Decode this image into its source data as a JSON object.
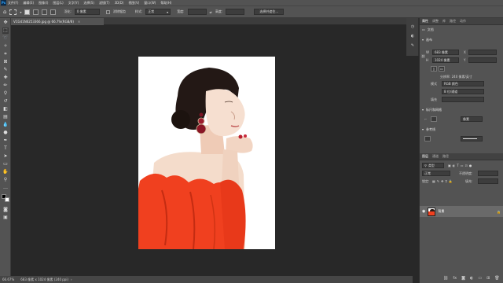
{
  "menubar": {
    "logo": "Ps",
    "items": [
      "文件(F)",
      "编辑(E)",
      "图像(I)",
      "图层(L)",
      "文字(Y)",
      "选择(S)",
      "滤镜(T)",
      "3D(D)",
      "视图(V)",
      "窗口(W)",
      "帮助(H)"
    ]
  },
  "options": {
    "feather_label": "羽化:",
    "feather_value": "0 像素",
    "antialias_label": "消除锯齿",
    "style_label": "样式:",
    "style_value": "正常",
    "width_label": "宽度:",
    "height_label": "高度:",
    "select_mask_button": "选择并遮住..."
  },
  "document": {
    "tab_title": "VCG41N6253366.jpg @ 66.7%(RGB/8)",
    "close_glyph": "×"
  },
  "status": {
    "zoom": "66.67%",
    "doc_info": "683 像素 x 1024 像素 (240 ppi)"
  },
  "panels": {
    "top_tabs": [
      "属性",
      "调整",
      "库",
      "路径",
      "动作"
    ],
    "active_top_tab": "属性",
    "section_document": "文档",
    "section_canvas": "画布",
    "w_label": "W",
    "w_value": "683 像素",
    "x_label": "X",
    "h_label": "H",
    "h_value": "1024 像素",
    "y_label": "Y",
    "resolution": "分辨率: 240 像素/英寸",
    "mode_label": "模式",
    "mode_value": "RGB 颜色",
    "depth_value": "8 位/通道",
    "fill_label": "填充",
    "section_rulers": "标尺和网格",
    "rulers_unit": "像素",
    "section_guides": "参考线",
    "layers_tabs": [
      "图层",
      "通道",
      "路径"
    ],
    "active_layers_tab": "图层",
    "layer_kind": "类型",
    "blend_mode": "正常",
    "opacity_label": "不透明度:",
    "lock_label": "锁定:",
    "fill_opacity_label": "填充:",
    "layer_name": "背景"
  },
  "colors": {
    "accent": "#31a8ff",
    "dress": "#f0401f",
    "panel_bg": "#535353",
    "canvas_bg": "#282828"
  }
}
